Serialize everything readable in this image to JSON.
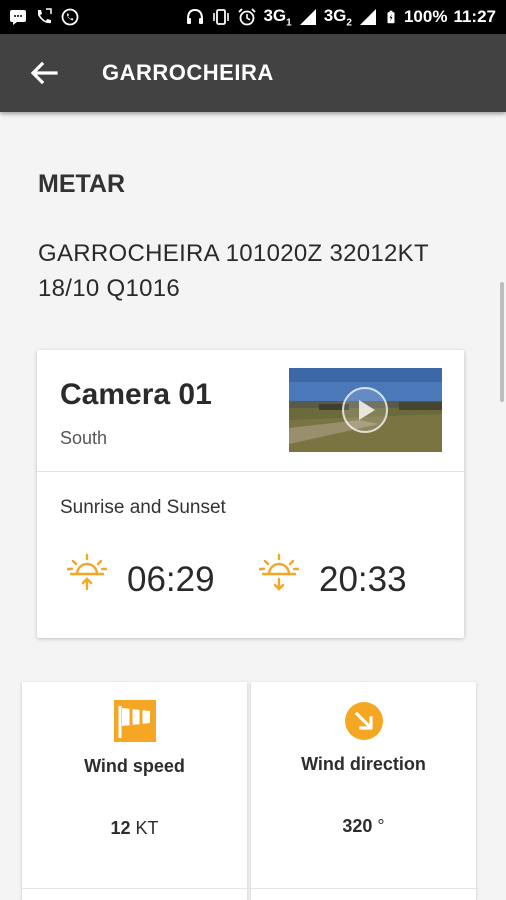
{
  "status_bar": {
    "battery": "100%",
    "time": "11:27",
    "net1": "3G",
    "net1_sub": "1",
    "net2": "3G",
    "net2_sub": "2",
    "icons": [
      "message-icon",
      "call-icon",
      "whatsapp-icon",
      "headset-icon",
      "vibrate-icon",
      "alarm-icon",
      "signal-icon",
      "battery-icon"
    ]
  },
  "app_bar": {
    "title": "GARROCHEIRA"
  },
  "metar": {
    "title": "METAR",
    "text": "GARROCHEIRA 101020Z 32012KT 18/10 Q1016"
  },
  "camera": {
    "name": "Camera 01",
    "direction": "South",
    "sun_label": "Sunrise and Sunset",
    "sunrise": "06:29",
    "sunset": "20:33"
  },
  "tiles": [
    {
      "label": "Wind speed",
      "value": "12",
      "unit": "KT",
      "icon": "windsock-icon"
    },
    {
      "label": "Wind direction",
      "value": "320",
      "unit": "°",
      "icon": "direction-arrow-icon"
    }
  ],
  "colors": {
    "accent": "#F5A623",
    "appbar": "#424242",
    "background": "#F4F4F4"
  }
}
